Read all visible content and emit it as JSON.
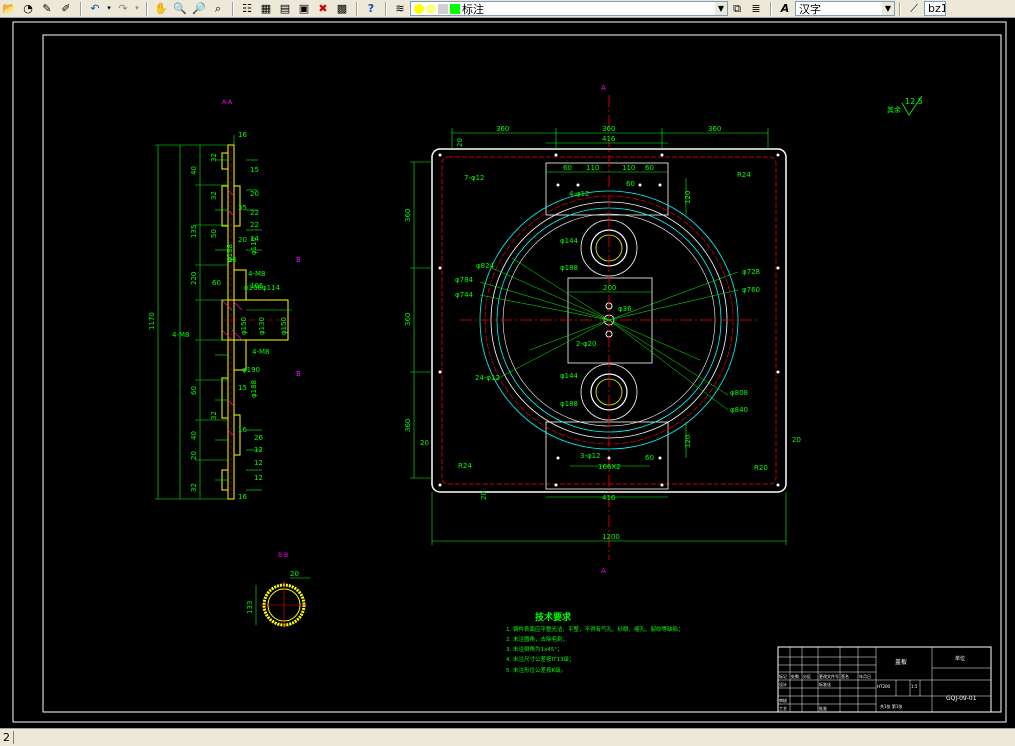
{
  "toolbar": {
    "buttons": [
      "open-icon",
      "save-icon",
      "pencil-icon",
      "eraser-icon",
      "undo-icon",
      "redo-icon",
      "pan-icon",
      "zoom-realtime-icon",
      "zoom-window-icon",
      "zoom-previous-icon",
      "properties-icon",
      "design-center-icon",
      "tool-palette-icon",
      "sheet-set-icon",
      "markup-icon",
      "calculator-icon",
      "help-icon"
    ],
    "layer_name": "标注",
    "textstyle_name": "汉字",
    "right_combo_text": "bz1",
    "colors": {
      "bg": "#ece9d8",
      "layer_bulb": "#ffff00",
      "layer_swatch": "#00ff00"
    }
  },
  "drawing": {
    "section_aa_label": "A-A",
    "section_bb_label": "B-B",
    "section_markers": [
      "A",
      "A",
      "B",
      "B"
    ],
    "roughness_note": "其余",
    "roughness_value": "12.5",
    "pipe_dim_left": "133",
    "pipe_dim_right": "20",
    "side_dims": [
      "16",
      "32",
      "15",
      "20",
      "40",
      "32",
      "35",
      "22",
      "135",
      "20",
      "50",
      "25",
      "220",
      "105",
      "60",
      "32",
      "60",
      "15",
      "1170",
      "16",
      "32",
      "12",
      "40",
      "16",
      "20",
      "12",
      "26",
      "12",
      "22",
      "14"
    ],
    "side_callouts": [
      "4-M8",
      "4-M8",
      "4-M8",
      "φ110",
      "φ114",
      "φ106",
      "φ188",
      "φ150",
      "φ130",
      "φ150",
      "φ190",
      "φ188"
    ],
    "plan_dims": {
      "top_segments": [
        "360",
        "360",
        "360"
      ],
      "width_416_top": "416",
      "width_416_bottom": "416",
      "top_60": "60",
      "top_110a": "110",
      "top_110b": "110",
      "top_60b": "60",
      "left_360a": "360",
      "left_360b": "360",
      "left_360c": "360",
      "overall_1200": "1200",
      "r24": "R24",
      "r20": "R20",
      "d20_left": "20",
      "d20_right": "20",
      "d20_bottom": "20",
      "d120_top": "120",
      "d120_bottom": "120",
      "d200": "200",
      "hole_7": "7-φ12",
      "hole_4": "4-φ12",
      "hole_3": "3-φ12",
      "hole_2": "2-φ20",
      "hole_24": "24-φ12",
      "d1662": "166X2",
      "d140": "φ144",
      "d168": "φ188",
      "d144b": "φ144",
      "d188b": "φ188",
      "d824": "φ824",
      "d784": "φ784",
      "d744": "φ744",
      "d728": "φ728",
      "d760": "φ760",
      "d808": "φ808",
      "d840": "φ840",
      "d36": "φ36",
      "d20b": "20",
      "d60": "60",
      "d60b": "60"
    },
    "tech_title": "技术要求",
    "tech_notes": [
      "1. 铸件表面应平整光洁、平整，不得有气孔、砂眼、缩孔、裂纹等缺陷；",
      "2. 未注圆角，去除毛刺；",
      "3. 未注倒角为1x45°；",
      "4. 未注尺寸公差按IT13级；",
      "5. 未注形位公差按K级。"
    ],
    "title_block": {
      "part_name": "盖板",
      "company": "单位",
      "drawing_no": "GQJ-09-01",
      "scale": "1:5",
      "material": "HT200",
      "sheet": "共1张 第1张",
      "row_labels": [
        "标记",
        "处数",
        "分区",
        "更改文件号",
        "签名",
        "年月日"
      ],
      "design": "设计",
      "check": "审核",
      "process": "工艺",
      "approve": "批准",
      "std": "标准化"
    },
    "colors": {
      "border": "#ffffff",
      "dim": "#00ff00",
      "object_yellow": "#ffff00",
      "center": "#ff0000",
      "hidden": "#00ffff",
      "magenta": "#ff00ff"
    }
  },
  "statusbar": {
    "prefix": "2",
    "command_text": ""
  }
}
